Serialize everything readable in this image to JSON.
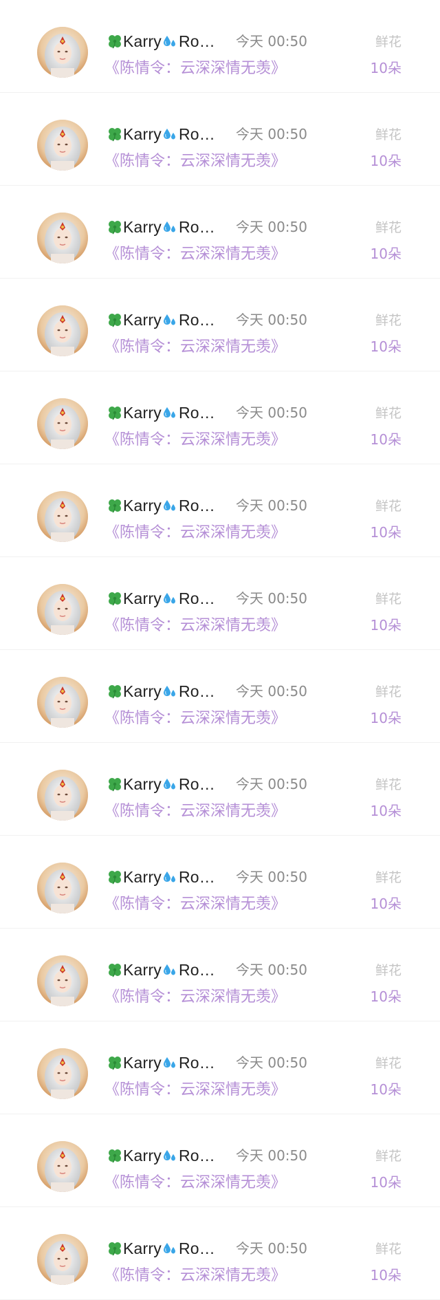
{
  "records": [
    {
      "user": "Karry",
      "time": "今天 00:50",
      "work": "《陈情令：云深深情无羡》",
      "gift": "鲜花",
      "count": "10朵"
    },
    {
      "user": "Karry",
      "time": "今天 00:50",
      "work": "《陈情令：云深深情无羡》",
      "gift": "鲜花",
      "count": "10朵"
    },
    {
      "user": "Karry",
      "time": "今天 00:50",
      "work": "《陈情令：云深深情无羡》",
      "gift": "鲜花",
      "count": "10朵"
    },
    {
      "user": "Karry",
      "time": "今天 00:50",
      "work": "《陈情令：云深深情无羡》",
      "gift": "鲜花",
      "count": "10朵"
    },
    {
      "user": "Karry",
      "time": "今天 00:50",
      "work": "《陈情令：云深深情无羡》",
      "gift": "鲜花",
      "count": "10朵"
    },
    {
      "user": "Karry",
      "time": "今天 00:50",
      "work": "《陈情令：云深深情无羡》",
      "gift": "鲜花",
      "count": "10朵"
    },
    {
      "user": "Karry",
      "time": "今天 00:50",
      "work": "《陈情令：云深深情无羡》",
      "gift": "鲜花",
      "count": "10朵"
    },
    {
      "user": "Karry",
      "time": "今天 00:50",
      "work": "《陈情令：云深深情无羡》",
      "gift": "鲜花",
      "count": "10朵"
    },
    {
      "user": "Karry",
      "time": "今天 00:50",
      "work": "《陈情令：云深深情无羡》",
      "gift": "鲜花",
      "count": "10朵"
    },
    {
      "user": "Karry",
      "time": "今天 00:50",
      "work": "《陈情令：云深深情无羡》",
      "gift": "鲜花",
      "count": "10朵"
    },
    {
      "user": "Karry",
      "time": "今天 00:50",
      "work": "《陈情令：云深深情无羡》",
      "gift": "鲜花",
      "count": "10朵"
    },
    {
      "user": "Karry",
      "time": "今天 00:50",
      "work": "《陈情令：云深深情无羡》",
      "gift": "鲜花",
      "count": "10朵"
    },
    {
      "user": "Karry",
      "time": "今天 00:50",
      "work": "《陈情令：云深深情无羡》",
      "gift": "鲜花",
      "count": "10朵"
    },
    {
      "user": "Karry",
      "time": "今天 00:50",
      "work": "《陈情令：云深深情无羡》",
      "gift": "鲜花",
      "count": "10朵"
    }
  ],
  "user_suffix": "Ro…",
  "icons": {
    "prefix": "clover-icon",
    "mid": "droplets-icon"
  },
  "colors": {
    "accent_purple": "#b58fd6",
    "muted_gray": "#c4c4c4",
    "time_gray": "#8a8a8a",
    "name_black": "#222222",
    "clover_green": "#3ea84a",
    "droplet_blue": "#3aa6e8"
  }
}
